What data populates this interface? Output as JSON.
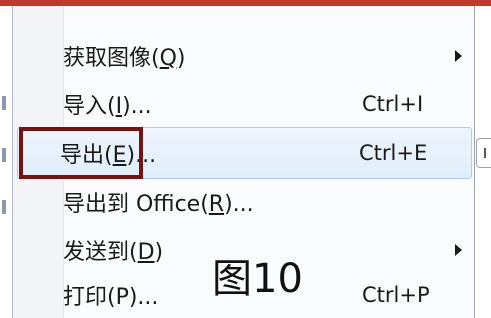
{
  "menu": {
    "items": [
      {
        "label": "获取图像(",
        "mnemonic": "Q",
        "label_end": ")",
        "shortcut": "",
        "has_submenu": true,
        "highlighted": false
      },
      {
        "label": "导入(",
        "mnemonic": "I",
        "label_end": ")...",
        "shortcut": "Ctrl+I",
        "has_submenu": false,
        "highlighted": false
      },
      {
        "label": "导出(",
        "mnemonic": "E",
        "label_end": ")...",
        "shortcut": "Ctrl+E",
        "has_submenu": false,
        "highlighted": true
      },
      {
        "label": "导出到 Office(",
        "mnemonic": "R",
        "label_end": ")...",
        "shortcut": "",
        "has_submenu": false,
        "highlighted": false
      },
      {
        "label": "发送到(",
        "mnemonic": "D",
        "label_end": ")",
        "shortcut": "",
        "has_submenu": true,
        "highlighted": false
      },
      {
        "label": "打印(P)...",
        "mnemonic": "",
        "label_end": "",
        "shortcut": "Ctrl+P",
        "has_submenu": false,
        "highlighted": false
      }
    ]
  },
  "caption": "图10",
  "colors": {
    "top_rule": "#c0392b",
    "highlight_fill": "#dfeefc",
    "highlight_border": "#a9cff2",
    "annotation_box": "#7a1010"
  }
}
